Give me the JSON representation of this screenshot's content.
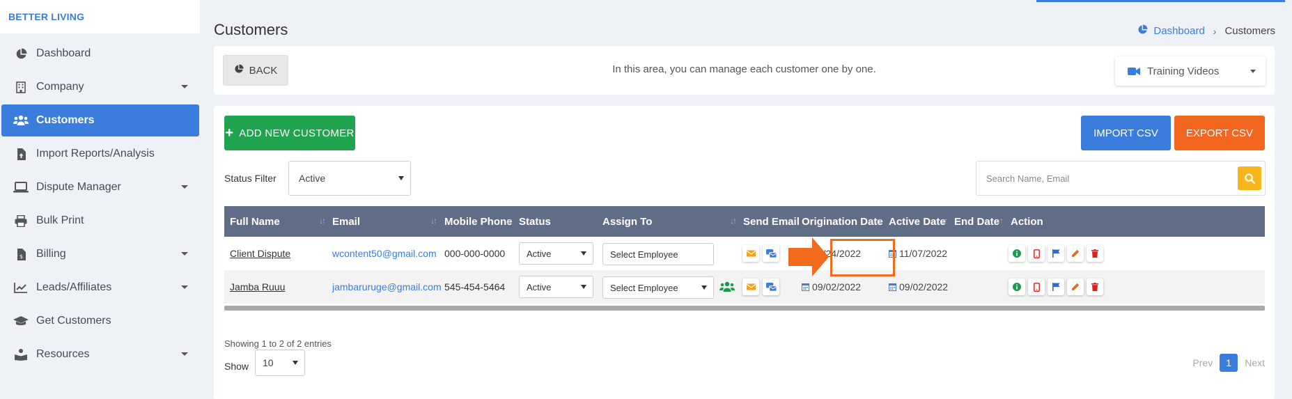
{
  "brand": "BETTER LIVING",
  "sidebar": {
    "items": [
      {
        "label": "Dashboard",
        "icon": "pie-chart-icon",
        "has_caret": false
      },
      {
        "label": "Company",
        "icon": "building-icon",
        "has_caret": true
      },
      {
        "label": "Customers",
        "icon": "users-icon",
        "has_caret": false,
        "active": true
      },
      {
        "label": "Import Reports/Analysis",
        "icon": "file-upload-icon",
        "has_caret": false
      },
      {
        "label": "Dispute Manager",
        "icon": "laptop-icon",
        "has_caret": true
      },
      {
        "label": "Bulk Print",
        "icon": "printer-icon",
        "has_caret": false
      },
      {
        "label": "Billing",
        "icon": "invoice-icon",
        "has_caret": true
      },
      {
        "label": "Leads/Affiliates",
        "icon": "line-chart-icon",
        "has_caret": true
      },
      {
        "label": "Get Customers",
        "icon": "graduation-cap-icon",
        "has_caret": false
      },
      {
        "label": "Resources",
        "icon": "book-reader-icon",
        "has_caret": true
      }
    ]
  },
  "header": {
    "title": "Customers",
    "breadcrumb": {
      "home": "Dashboard",
      "current": "Customers"
    }
  },
  "info": {
    "back_label": "BACK",
    "text": "In this area, you can manage each customer one by one.",
    "training_label": "Training Videos"
  },
  "toolbar": {
    "add_label": "ADD NEW CUSTOMER",
    "import_label": "IMPORT CSV",
    "export_label": "EXPORT CSV",
    "status_filter_label": "Status Filter",
    "status_filter_value": "Active",
    "search_placeholder": "Search Name, Email"
  },
  "table": {
    "columns": [
      "Full Name",
      "Email",
      "Mobile Phone",
      "Status",
      "Assign To",
      "Send Email",
      "Origination Date",
      "Active Date",
      "End Date",
      "Action"
    ],
    "rows": [
      {
        "name": "Client Dispute",
        "email": "wcontent50@gmail.com",
        "phone": "000-000-0000",
        "status": "Active",
        "assign": "Select Employee",
        "origination": "10/24/2022",
        "active_date": "11/07/2022",
        "end_date": ""
      },
      {
        "name": "Jamba Ruuu",
        "email": "jambaruruge@gmail.com",
        "phone": "545-454-5464",
        "status": "Active",
        "assign": "Select Employee",
        "origination": "09/02/2022",
        "active_date": "09/02/2022",
        "end_date": ""
      }
    ]
  },
  "footer": {
    "entries_text": "Showing 1 to 2 of 2 entries",
    "show_label": "Show",
    "page_size": "10",
    "prev_label": "Prev",
    "page": "1",
    "next_label": "Next"
  },
  "colors": {
    "primary": "#3b7ddd",
    "success": "#21a450",
    "export": "#f2661f",
    "search": "#f8b61b",
    "table_header": "#5f6e86",
    "highlight": "#f26a1b"
  }
}
